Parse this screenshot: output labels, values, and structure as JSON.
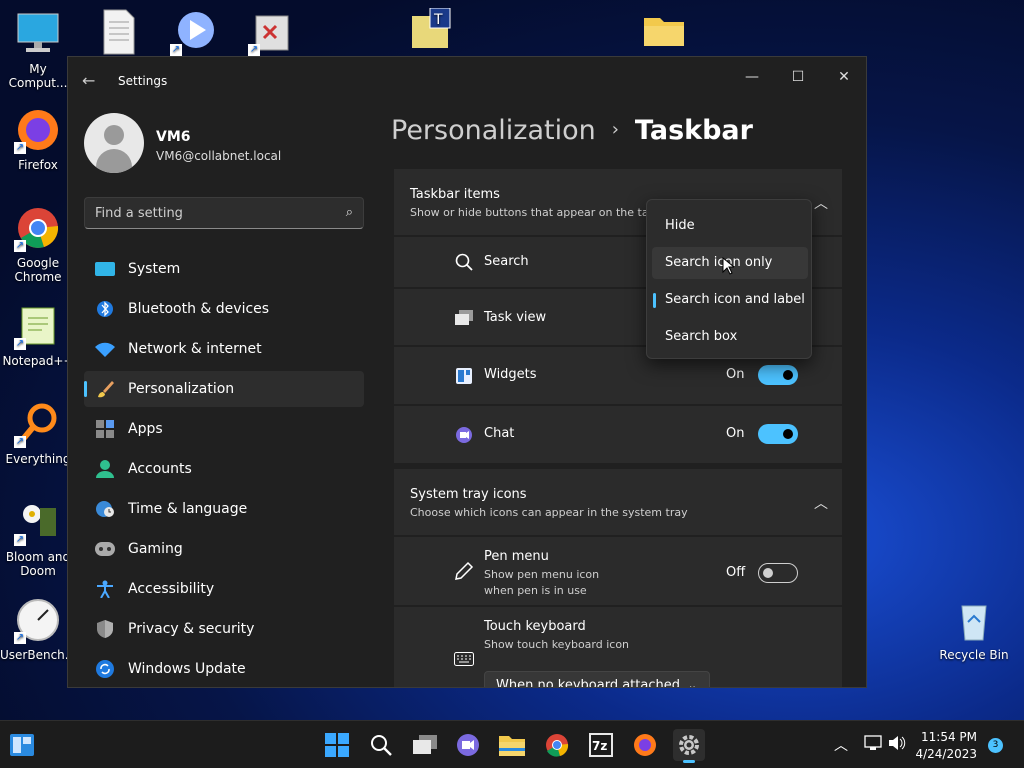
{
  "desktop": {
    "icons": [
      {
        "label": "My Comput...",
        "icon": "computer-icon"
      },
      {
        "label": "Firefox",
        "icon": "firefox-icon"
      },
      {
        "label": "Google Chrome",
        "icon": "chrome-icon"
      },
      {
        "label": "Notepad++",
        "icon": "notepad-plus-plus-icon"
      },
      {
        "label": "Everything",
        "icon": "everything-search-icon"
      },
      {
        "label": "Bloom and Doom",
        "icon": "bloom-and-doom-icon"
      },
      {
        "label": "UserBench...",
        "icon": "userbenchmark-icon"
      },
      {
        "label": "Recycle Bin",
        "icon": "recycle-bin-icon"
      }
    ]
  },
  "window": {
    "title": "Settings",
    "user": {
      "name": "VM6",
      "email": "VM6@collabnet.local"
    },
    "search": {
      "placeholder": "Find a setting"
    },
    "nav": [
      {
        "label": "System",
        "icon": "system-icon",
        "active": false
      },
      {
        "label": "Bluetooth & devices",
        "icon": "bluetooth-icon",
        "active": false
      },
      {
        "label": "Network & internet",
        "icon": "wifi-icon",
        "active": false
      },
      {
        "label": "Personalization",
        "icon": "brush-icon",
        "active": true
      },
      {
        "label": "Apps",
        "icon": "apps-icon",
        "active": false
      },
      {
        "label": "Accounts",
        "icon": "accounts-icon",
        "active": false
      },
      {
        "label": "Time & language",
        "icon": "globe-clock-icon",
        "active": false
      },
      {
        "label": "Gaming",
        "icon": "gamepad-icon",
        "active": false
      },
      {
        "label": "Accessibility",
        "icon": "accessibility-icon",
        "active": false
      },
      {
        "label": "Privacy & security",
        "icon": "shield-icon",
        "active": false
      },
      {
        "label": "Windows Update",
        "icon": "update-icon",
        "active": false
      }
    ],
    "breadcrumb": {
      "parent": "Personalization",
      "separator": "›",
      "current": "Taskbar"
    },
    "taskbar_items": {
      "title": "Taskbar items",
      "subtitle": "Show or hide buttons that appear on the tas",
      "rows": [
        {
          "label": "Search",
          "icon": "search-icon"
        },
        {
          "label": "Task view",
          "icon": "task-view-icon"
        },
        {
          "label": "Widgets",
          "icon": "widgets-icon",
          "state": "On"
        },
        {
          "label": "Chat",
          "icon": "chat-icon",
          "state": "On"
        }
      ]
    },
    "system_tray": {
      "title": "System tray icons",
      "subtitle": "Choose which icons can appear in the system tray",
      "pen_menu": {
        "label": "Pen menu",
        "sub1": "Show pen menu icon",
        "sub2": "when pen is in use",
        "state": "Off"
      },
      "touch_keyboard": {
        "label": "Touch keyboard",
        "sub": "Show touch keyboard icon",
        "dropdown": "When no keyboard attached"
      }
    },
    "search_menu": {
      "options": [
        "Hide",
        "Search icon only",
        "Search icon and label",
        "Search box"
      ],
      "selected": "Search icon and label",
      "hovered": "Search icon only"
    }
  },
  "taskbar": {
    "clock": {
      "time": "11:54 PM",
      "date": "4/24/2023"
    },
    "notification_count": "3",
    "zip_label": "7z"
  },
  "colors": {
    "accent": "#4cc2ff",
    "window_bg": "#202020",
    "card_bg": "#2b2b2b"
  }
}
